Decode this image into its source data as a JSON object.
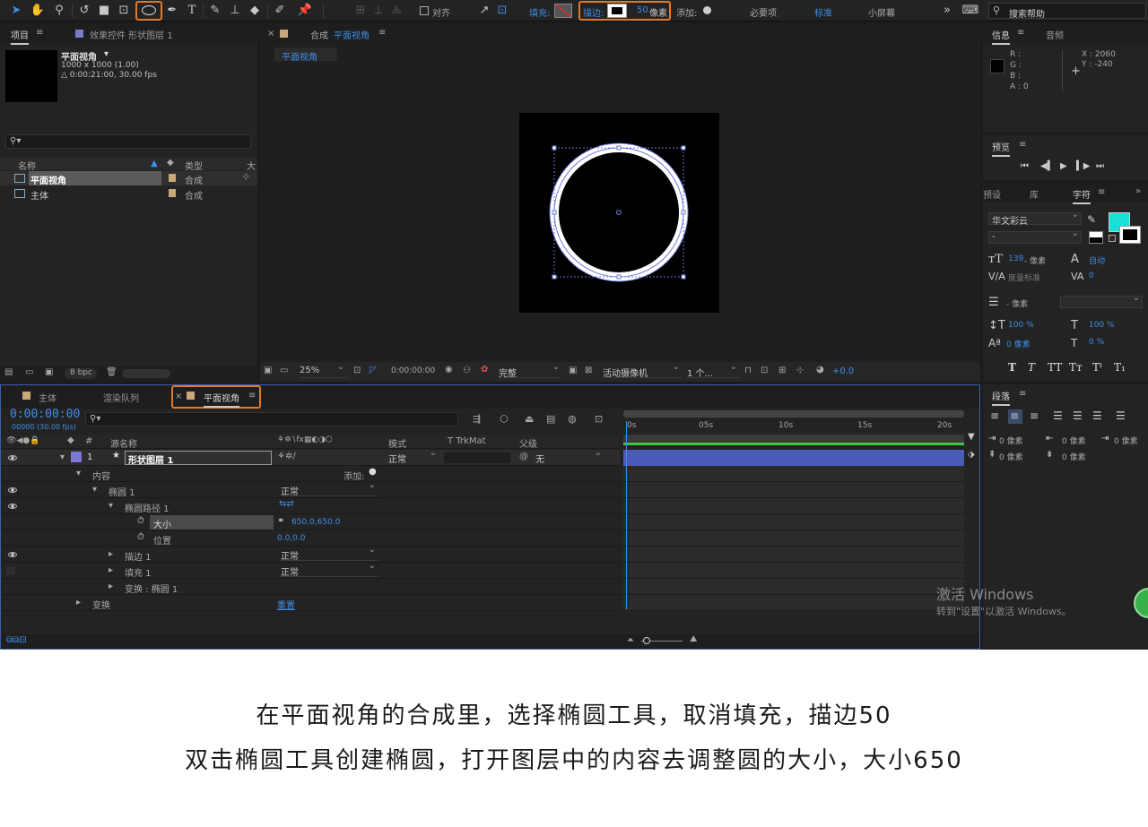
{
  "toolbar": {
    "fill_label": "填充:",
    "stroke_label": "描边:",
    "stroke_width": "50",
    "stroke_unit": "像素",
    "add_label": "添加:",
    "align_label": "对齐",
    "workspaces": [
      "必要项",
      "标准",
      "小屏幕"
    ],
    "active_workspace": "标准",
    "search_placeholder": "搜索帮助",
    "fill_color": "#cc3333",
    "accent_color": "#e07b2a"
  },
  "project": {
    "tab": "项目",
    "effects_tab": "效果控件 形状图层 1",
    "comp_name": "平面视角",
    "comp_size": "1000 x 1000 (1.00)",
    "comp_duration": "△ 0:00:21:00, 30.00 fps",
    "col_name": "名称",
    "col_type": "类型",
    "col_size": "大",
    "items": [
      {
        "name": "平面视角",
        "type": "合成"
      },
      {
        "name": "主体",
        "type": "合成"
      }
    ],
    "bpc": "8 bpc"
  },
  "viewer": {
    "tab_prefix": "合成",
    "tab_name": "平面视角",
    "crumb": "平面视角",
    "zoom": "25%",
    "timecode": "0:00:00:00",
    "quality": "完整",
    "camera": "活动摄像机",
    "views": "1 个...",
    "exposure": "+0.0"
  },
  "info": {
    "tab": "信息",
    "audio_tab": "音频",
    "r": "R :",
    "g": "G :",
    "b": "B :",
    "a": "A : 0",
    "x": "X : 2060",
    "y": "Y : -240"
  },
  "preview": {
    "tab": "预览"
  },
  "character": {
    "tabs": [
      "预设",
      "库",
      "字符"
    ],
    "font": "华文彩云",
    "style": "-",
    "size_value": "139",
    "size_unit": "像素",
    "leading": "自动",
    "kerning": "度量标准",
    "tracking": "0",
    "stroke_unit": "- 像素",
    "vscale": "100 %",
    "hscale": "100 %",
    "baseline": "0 像素",
    "tsume": "0 %",
    "swatch_color": "#19e0d8"
  },
  "paragraph": {
    "tab": "段落",
    "values": [
      "0 像素",
      "0 像素",
      "0 像素",
      "0 像素",
      "0 像素"
    ]
  },
  "timeline": {
    "tabs": [
      "主体",
      "渲染队列",
      "平面视角"
    ],
    "timecode": "0:00:00:00",
    "fps_line": "00000 (30.00 fps)",
    "headers": {
      "source": "源名称",
      "mode": "模式",
      "trkmat": "T  TrkMat",
      "parent": "父级",
      "num": "#"
    },
    "layer": {
      "num": "1",
      "name": "形状图层 1",
      "mode": "正常",
      "parent": "无"
    },
    "content_label": "内容",
    "add_label": "添加:",
    "ellipse": "椭圆 1",
    "ellipse_mode": "正常",
    "path": "椭圆路径 1",
    "size_label": "大小",
    "size_value": "650.0,650.0",
    "pos_label": "位置",
    "pos_value": "0.0,0.0",
    "stroke": "描边 1",
    "stroke_mode": "正常",
    "fill": "填充 1",
    "fill_mode": "正常",
    "transform_ellipse": "变换 : 椭圆 1",
    "transform": "变换",
    "reset": "重置",
    "ruler": [
      "0s",
      "05s",
      "10s",
      "15s",
      "20s"
    ]
  },
  "watermark": {
    "title": "激活 Windows",
    "sub": "转到\"设置\"以激活 Windows。"
  },
  "captions": [
    "在平面视角的合成里，选择椭圆工具，取消填充，描边50",
    "双击椭圆工具创建椭圆，打开图层中的内容去调整圆的大小，大小650"
  ]
}
